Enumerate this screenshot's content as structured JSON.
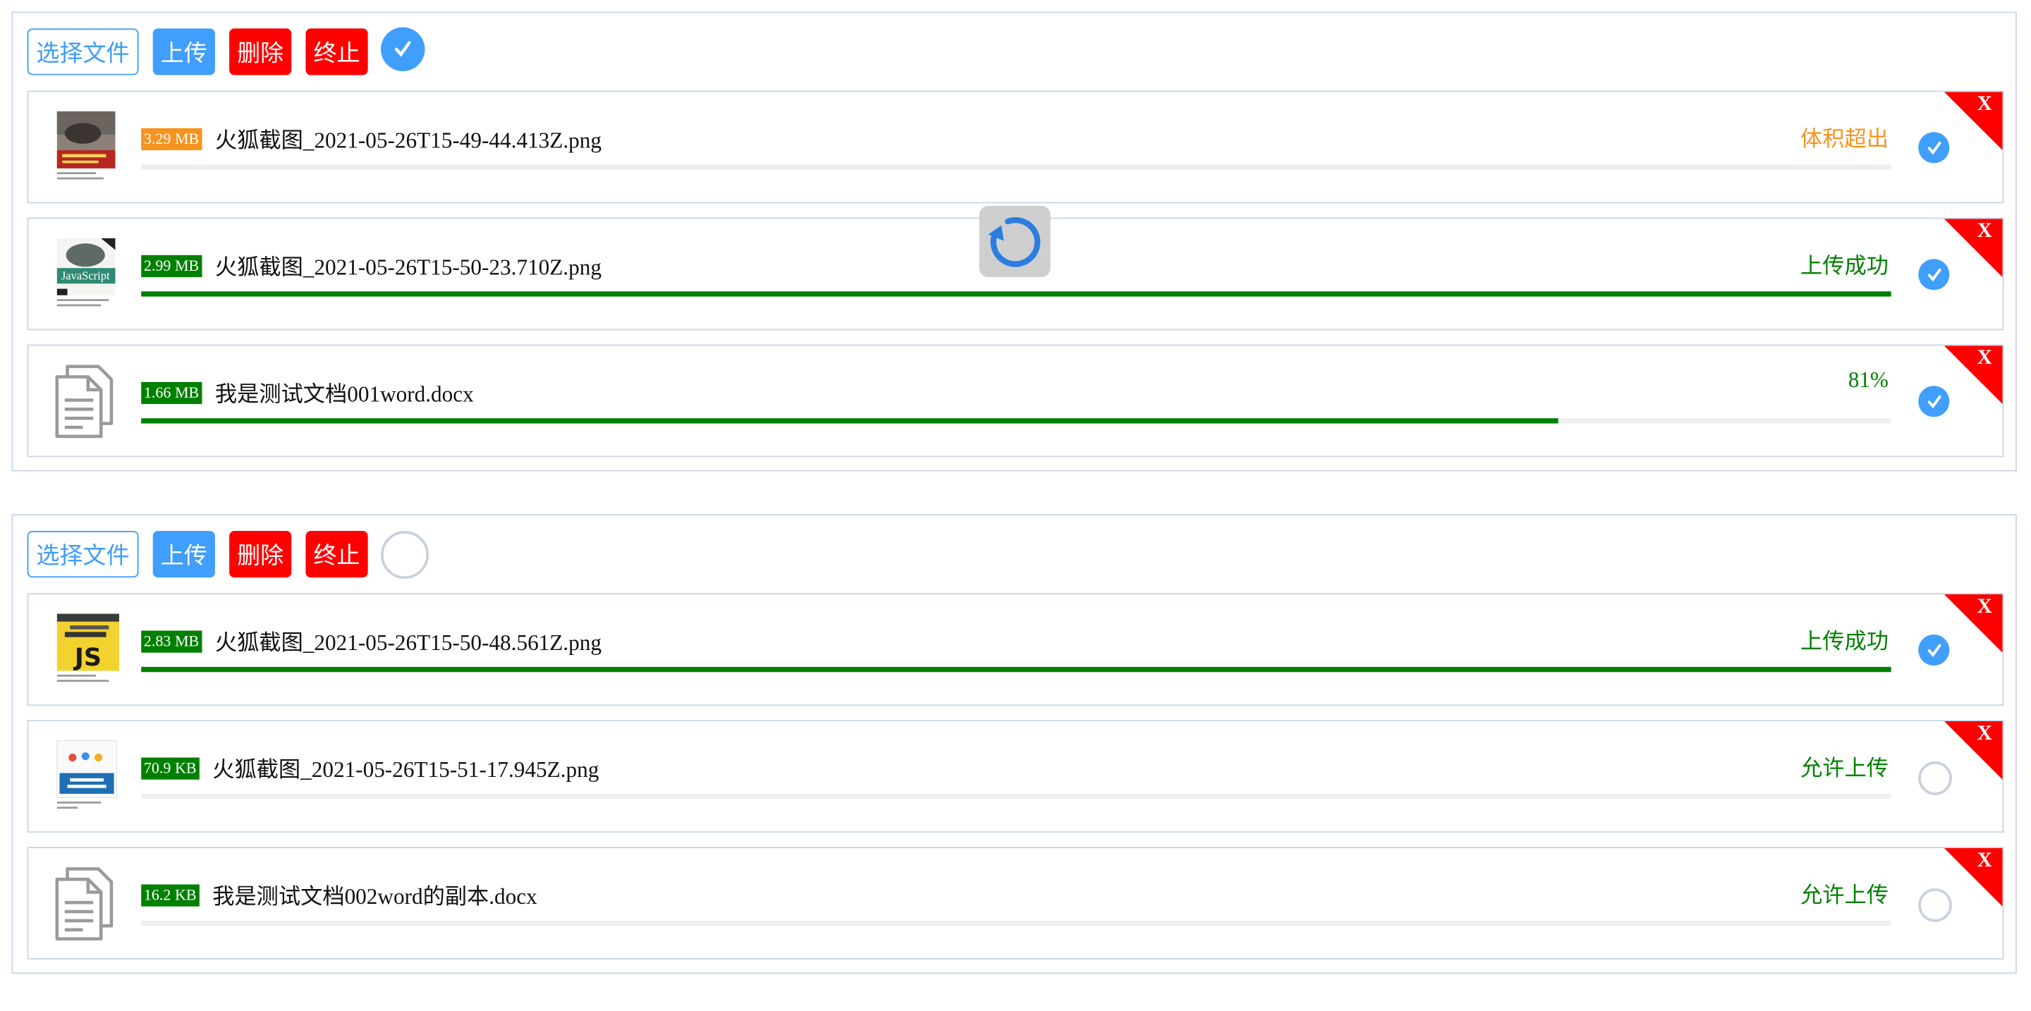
{
  "colors": {
    "primary": "#409efd",
    "danger": "#ff0000",
    "success": "#008000",
    "warning": "#f7931e",
    "track": "#eeeeee"
  },
  "panels": [
    {
      "toolbar": {
        "select_label": "选择文件",
        "upload_label": "上传",
        "delete_label": "删除",
        "stop_label": "终止",
        "select_all_checked": true
      },
      "files": [
        {
          "size": "3.29 MB",
          "name": "火狐截图_2021-05-26T15-49-44.413Z.png",
          "status": "体积超出",
          "status_kind": "warning",
          "progress": 0,
          "checked": true,
          "remove_label": "X",
          "thumb_icon": "book-cover-javascript-professional-icon"
        },
        {
          "size": "2.99 MB",
          "name": "火狐截图_2021-05-26T15-50-23.710Z.png",
          "status": "上传成功",
          "status_kind": "success",
          "progress": 1.0,
          "checked": true,
          "remove_label": "X",
          "thumb_icon": "book-cover-javascript-rhino-icon"
        },
        {
          "size": "1.66 MB",
          "name": "我是测试文档001word.docx",
          "status": "81%",
          "status_kind": "percent",
          "progress": 0.81,
          "checked": true,
          "remove_label": "X",
          "thumb_icon": "document-file-icon"
        }
      ]
    },
    {
      "toolbar": {
        "select_label": "选择文件",
        "upload_label": "上传",
        "delete_label": "删除",
        "stop_label": "终止",
        "select_all_checked": false
      },
      "files": [
        {
          "size": "2.83 MB",
          "name": "火狐截图_2021-05-26T15-50-48.561Z.png",
          "status": "上传成功",
          "status_kind": "success",
          "progress": 1.0,
          "checked": true,
          "remove_label": "X",
          "thumb_icon": "book-cover-javascript-js-icon"
        },
        {
          "size": "70.9 KB",
          "name": "火狐截图_2021-05-26T15-51-17.945Z.png",
          "status": "允许上传",
          "status_kind": "success",
          "progress": 0,
          "checked": false,
          "remove_label": "X",
          "thumb_icon": "book-cover-react-redux-icon"
        },
        {
          "size": "16.2 KB",
          "name": "我是测试文档002word的副本.docx",
          "status": "允许上传",
          "status_kind": "success",
          "progress": 0,
          "checked": false,
          "remove_label": "X",
          "thumb_icon": "document-file-icon"
        }
      ]
    }
  ],
  "overlay": {
    "icon": "refresh-icon"
  }
}
